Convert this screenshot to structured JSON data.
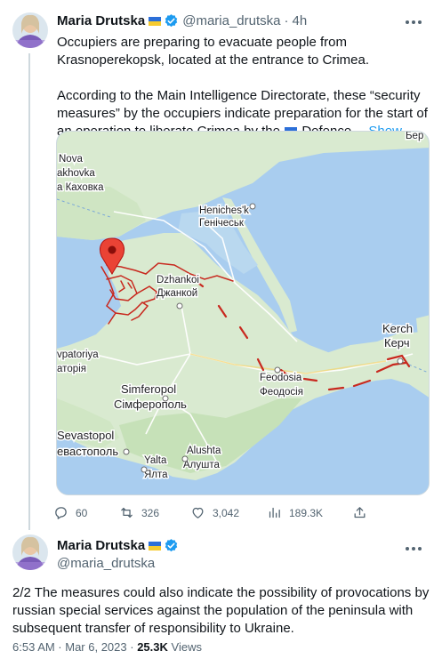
{
  "tweet1": {
    "author": {
      "display_name": "Maria Drutska",
      "handle": "@maria_drutska",
      "time": "4h"
    },
    "text": {
      "p1": "Occupiers are preparing to evacuate people from Krasnoperekopsk, located at the entrance to Crimea.",
      "p2_before_flag": "According to the Main Intelligence Directorate, these “security measures” by the occupiers indicate preparation for the start of an operation to liberate Crimea by the",
      "p2_after_flag": "Defence…",
      "show_more": "Show more"
    },
    "map": {
      "labels": {
        "nova": "Nova",
        "kakhovka_en": "akhovka",
        "kakhovka_ua": "а Каховка",
        "henichesk_en": "Heniches'k",
        "henichesk_ua": "Генічеськ",
        "dzhankoi_en": "Dzhankoi",
        "dzhankoi_ua": "Джанкой",
        "kerch_en": "Kerch",
        "kerch_ua": "Керч",
        "yevpatoriya_en": "vpatoriya",
        "yevpatoriya_ua": "атopiя",
        "feodosia_en": "Feodosia",
        "feodosia_ua": "Феодосія",
        "simferopol_en": "Simferopol",
        "simferopol_ua": "Сімферополь",
        "sevastopol_en": "Sevastopol",
        "sevastopol_ua": "евастополь",
        "alushta_en": "Alushta",
        "alushta_ua": "Алушта",
        "yalta_en": "Yalta",
        "yalta_ua": "Ялта",
        "corner": "Бер"
      },
      "colors": {
        "sea": "#a9cdef",
        "land": "#d9ead0",
        "land_dark": "#c6e1b8",
        "road": "#ffffff",
        "pin": "#d93025",
        "drawing": "#c8281e"
      }
    },
    "actions": {
      "replies": "60",
      "retweets": "326",
      "likes": "3,042",
      "views": "189.3K"
    }
  },
  "tweet2": {
    "author": {
      "display_name": "Maria Drutska",
      "handle": "@maria_drutska"
    },
    "text": "2/2 The measures could also indicate the possibility of provocations by russian special services against the population of the peninsula with subsequent transfer of responsibility to Ukraine.",
    "timestamp": "6:53 AM · Mar 6, 2023",
    "separator": " · ",
    "views_count": "25.3K",
    "views_label": "Views"
  }
}
